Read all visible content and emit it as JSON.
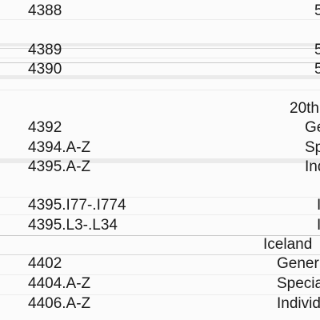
{
  "rows": [
    {
      "number": "4388",
      "text": "5"
    },
    {
      "number": "4389",
      "text": "5"
    },
    {
      "number": "4390",
      "text": "5"
    },
    {
      "number": "",
      "text": "20th"
    },
    {
      "number": "4392",
      "text": "Ge"
    },
    {
      "number": "4394.A-Z",
      "text": "Sp"
    },
    {
      "number": "4395.A-Z",
      "text": "Ind"
    },
    {
      "number": "4395.I77-.I774",
      "text": "I"
    },
    {
      "number": "4395.L3-.L34",
      "text": "I"
    },
    {
      "number": "",
      "text": "Iceland"
    },
    {
      "number": "4402",
      "text": "Gener"
    },
    {
      "number": "4404.A-Z",
      "text": "Specia"
    },
    {
      "number": "4406.A-Z",
      "text": "Individ"
    }
  ]
}
